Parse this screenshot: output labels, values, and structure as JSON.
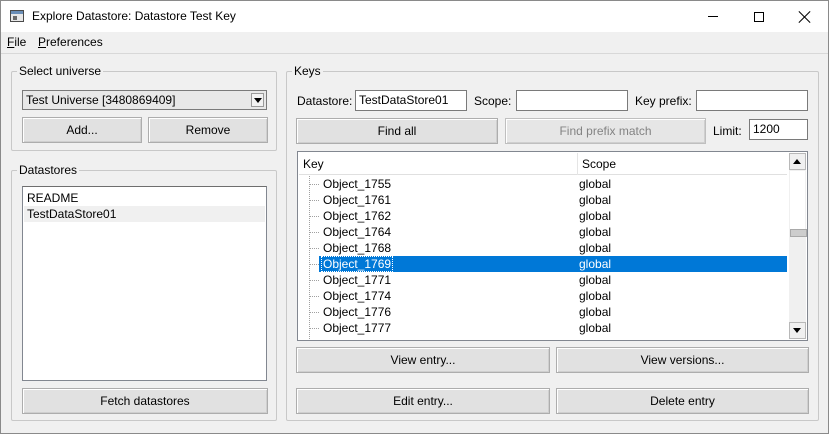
{
  "window": {
    "title": "Explore Datastore: Datastore Test Key"
  },
  "menu": {
    "file": {
      "accel": "F",
      "rest": "ile"
    },
    "preferences": {
      "accel": "P",
      "rest": "references"
    }
  },
  "universe": {
    "group_title": "Select universe",
    "selected": "Test Universe [3480869409]",
    "add_label": "Add...",
    "remove_label": "Remove"
  },
  "datastores": {
    "group_title": "Datastores",
    "items": [
      "README",
      "TestDataStore01"
    ],
    "selected_index": 1,
    "fetch_label": "Fetch datastores"
  },
  "keys": {
    "group_title": "Keys",
    "datastore_label": "Datastore:",
    "datastore_value": "TestDataStore01",
    "scope_label": "Scope:",
    "scope_value": "",
    "prefix_label": "Key prefix:",
    "prefix_value": "",
    "find_all_label": "Find all",
    "find_prefix_label": "Find prefix match",
    "limit_label": "Limit:",
    "limit_value": "1200",
    "columns": [
      "Key",
      "Scope"
    ],
    "rows": [
      {
        "key": "Object_1755",
        "scope": "global"
      },
      {
        "key": "Object_1761",
        "scope": "global"
      },
      {
        "key": "Object_1762",
        "scope": "global"
      },
      {
        "key": "Object_1764",
        "scope": "global"
      },
      {
        "key": "Object_1768",
        "scope": "global"
      },
      {
        "key": "Object_1769",
        "scope": "global"
      },
      {
        "key": "Object_1771",
        "scope": "global"
      },
      {
        "key": "Object_1774",
        "scope": "global"
      },
      {
        "key": "Object_1776",
        "scope": "global"
      },
      {
        "key": "Object_1777",
        "scope": "global"
      }
    ],
    "selected_index": 5,
    "view_entry_label": "View entry...",
    "view_versions_label": "View versions...",
    "edit_entry_label": "Edit entry...",
    "delete_entry_label": "Delete entry"
  },
  "colors": {
    "selection": "#0078d7",
    "window_bg": "#f0f0f0"
  }
}
